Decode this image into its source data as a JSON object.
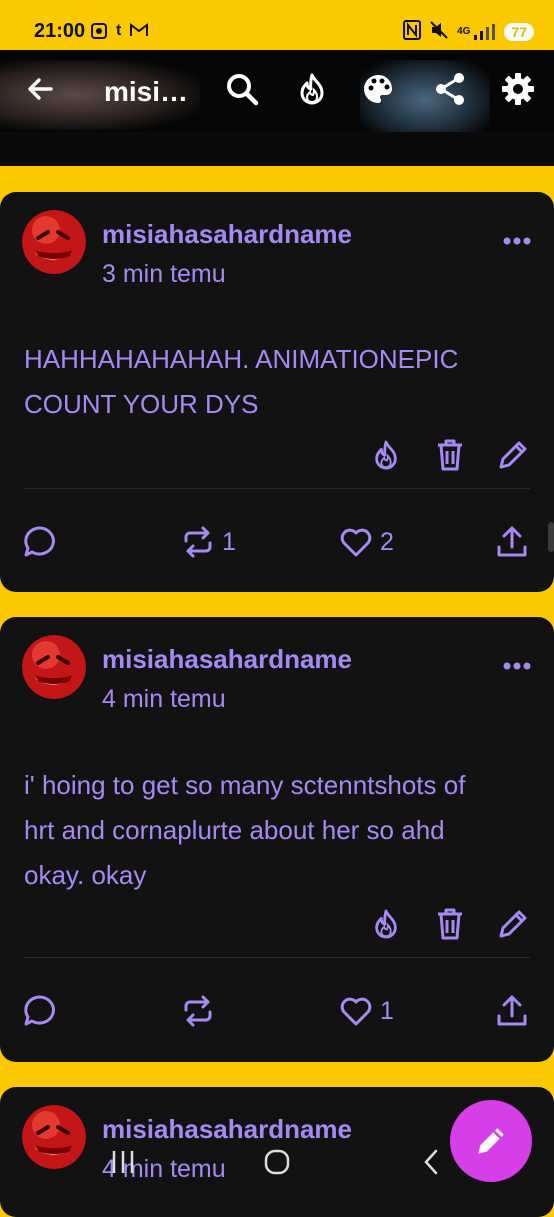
{
  "status": {
    "time": "21:00",
    "left_icons": [
      "screen-record-icon",
      "tumblr-icon",
      "gmail-icon"
    ],
    "right": [
      "nfc-icon",
      "mute-icon",
      "4g-signal-icon"
    ],
    "network": "4G",
    "battery": "77"
  },
  "toolbar": {
    "title": "misi…",
    "icons": [
      "back-arrow-icon",
      "search-icon",
      "flame-icon",
      "palette-icon",
      "share-icon",
      "gear-icon"
    ]
  },
  "posts": [
    {
      "username": "misiahasahardname",
      "time": "3 min temu",
      "text_lines": [
        "HAHHAHAHAHAH. ANIMATIONEPIC",
        "COUNT YOUR DYS"
      ],
      "reblogs": "1",
      "likes": "2"
    },
    {
      "username": "misiahasahardname",
      "time": "4 min temu",
      "text_lines": [
        "i' hoing to get so many sctenntshots of",
        "hrt and cornaplurte about her so ahd",
        "okay. okay"
      ],
      "reblogs": "",
      "likes": "1"
    },
    {
      "username": "misiahasahardname",
      "time": "4 min temu"
    }
  ],
  "colors": {
    "accent": "#a68af4",
    "background": "#fcc900",
    "card": "#121212",
    "fab": "#d63fe8"
  }
}
